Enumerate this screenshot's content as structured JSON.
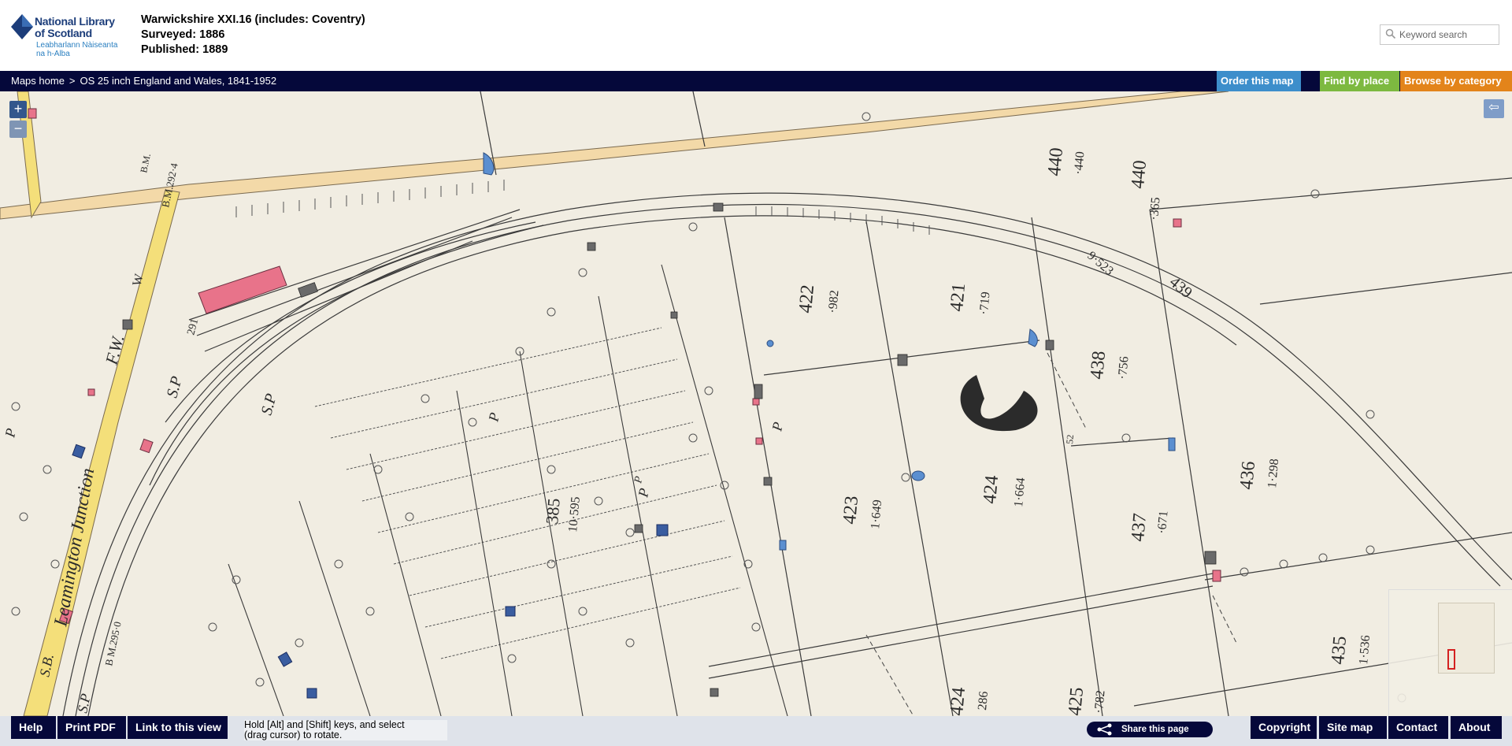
{
  "header": {
    "logo": {
      "line1": "National Library",
      "line2": "of Scotland",
      "gaelic1": "Leabharlann Nàiseanta",
      "gaelic2": "na h-Alba"
    },
    "map_title": "Warwickshire XXI.16 (includes: Coventry)",
    "surveyed": "Surveyed: 1886",
    "published": "Published: 1889",
    "search": {
      "placeholder": "Keyword search",
      "icon": "search-icon"
    }
  },
  "navbar": {
    "breadcrumb": [
      "Maps home",
      "OS 25 inch England and Wales, 1841-1952"
    ],
    "breadcrumb_separator": ">",
    "buttons": {
      "order": "Order this map",
      "find": "Find by place",
      "browse": "Browse by category"
    },
    "colors": {
      "bar": "#05083a",
      "order": "#3d8ecb",
      "find": "#7db940",
      "browse": "#e3841a"
    }
  },
  "map": {
    "zoom_in": "+",
    "zoom_out": "−",
    "collapse_icon": "⇦",
    "labels": {
      "bm_2924": "B.M.292·4",
      "n291": "291",
      "w": "W",
      "fw": "F.W.",
      "sp1": "S.P",
      "sp2": "S.P",
      "junction": "Leamington Junction",
      "sb": "S.B.",
      "p_left": "P",
      "bm_2950": "B M.295·0",
      "sp_bottom": "S.P",
      "p1": "P",
      "p2": "P",
      "p3": "P",
      "p4": "P",
      "n385": "385",
      "a385": "10·595",
      "n422": "422",
      "a422": "·982",
      "n421": "421",
      "a421": "·719",
      "n423": "423",
      "a423": "1·649",
      "n424": "424",
      "a424": "1·664",
      "n438": "438",
      "a438": "·756",
      "n437": "437",
      "a437": "·671",
      "n436": "436",
      "a436": "1·298",
      "n435": "435",
      "a435": "1·536",
      "n440": "440",
      "a440": "·440",
      "n440a": "440",
      "a440a": "·365",
      "n439": "439",
      "a439": "9·523",
      "n424a": "424",
      "a424a": "286",
      "n425": "425",
      "a425": "·782",
      "bench": "B.M.",
      "n52": "52"
    },
    "colors": {
      "paper": "#f1ede2",
      "road": "#f3d9a8",
      "road_yellow": "#f4df7a",
      "building": "#e8738a",
      "water": "#5b8fd0",
      "ink": "#3b3b3b"
    }
  },
  "footer": {
    "help": "Help",
    "print": "Print PDF",
    "link": "Link to this view",
    "rotate_line1": "Hold [Alt] and [Shift] keys, and select",
    "rotate_line2": "(drag cursor) to rotate.",
    "share": "Share this page",
    "copyright": "Copyright",
    "sitemap": "Site map",
    "contact": "Contact",
    "about": "About"
  }
}
